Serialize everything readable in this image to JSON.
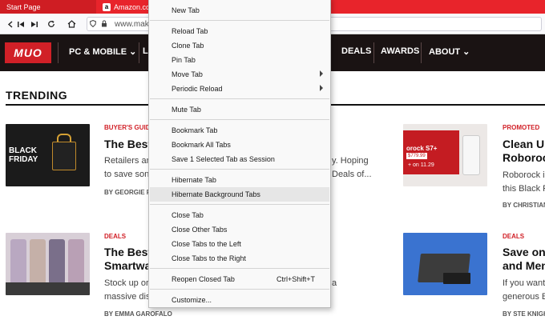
{
  "browser": {
    "tabs": [
      {
        "label": "Start Page"
      },
      {
        "label": "Amazon.co",
        "favicon": "a"
      }
    ],
    "url": "www.mak",
    "toolbar_icons": [
      "back-icon",
      "forward-icon",
      "reload-icon",
      "home-icon"
    ]
  },
  "site": {
    "logo": "MUO",
    "nav": [
      "PC & MOBILE ⌄",
      "L",
      "DEALS",
      "AWARDS",
      "ABOUT ⌄"
    ],
    "section_title": "TRENDING",
    "accent": "#d12027"
  },
  "articles": [
    {
      "category": "BUYER'S GUIDE",
      "headline": "The Best",
      "excerpt": [
        "Retailers an",
        "to save son"
      ],
      "byline": "BY GEORGIE P",
      "thumb_text": [
        "BLACK",
        "FRIDAY"
      ]
    },
    {
      "category": "DEALS",
      "headline": "The Best",
      "headline2": "Smartwa",
      "excerpt": [
        "Stock up or",
        "massive dis"
      ],
      "byline": "BY EMMA GAROFALO"
    },
    {
      "category": "PROMOTED",
      "headline": "Clean Up",
      "headline2": "Roboroc",
      "excerpt": [
        "Roborock is",
        "this Black F"
      ],
      "byline": "BY CHRISTIAN",
      "thumb_text": [
        "orock S7+",
        "$779.99",
        "+ on 11.29"
      ]
    },
    {
      "category": "DEALS",
      "headline": "Save on",
      "headline2": "and Men",
      "excerpt": [
        "If you want",
        "generous B"
      ],
      "byline": "BY STE KNIGHT"
    }
  ],
  "behind_menu_text": {
    "excerpt1_tail": [
      "y. Hoping",
      "Deals of..."
    ],
    "excerpt2_tail": [
      "a"
    ]
  },
  "context_menu": {
    "items": [
      {
        "label": "New Tab"
      },
      {
        "label": "Reload Tab"
      },
      {
        "label": "Clone Tab"
      },
      {
        "label": "Pin Tab"
      },
      {
        "label": "Move Tab",
        "submenu": true
      },
      {
        "label": "Periodic Reload",
        "submenu": true
      },
      {
        "label": "Mute Tab"
      },
      {
        "label": "Bookmark Tab"
      },
      {
        "label": "Bookmark All Tabs"
      },
      {
        "label": "Save 1 Selected Tab as Session"
      },
      {
        "label": "Hibernate Tab"
      },
      {
        "label": "Hibernate Background Tabs",
        "highlighted": true
      },
      {
        "label": "Close Tab"
      },
      {
        "label": "Close Other Tabs"
      },
      {
        "label": "Close Tabs to the Left"
      },
      {
        "label": "Close Tabs to the Right"
      },
      {
        "label": "Reopen Closed Tab",
        "shortcut": "Ctrl+Shift+T"
      },
      {
        "label": "Customize..."
      }
    ]
  }
}
